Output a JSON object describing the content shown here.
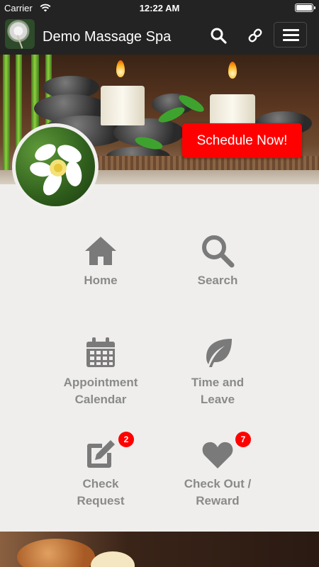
{
  "status_bar": {
    "carrier": "Carrier",
    "time": "12:22 AM"
  },
  "nav": {
    "title": "Demo Massage Spa"
  },
  "hero": {
    "schedule_label": "Schedule Now!"
  },
  "grid": [
    {
      "label_lines": [
        "Home"
      ],
      "icon": "home-icon"
    },
    {
      "label_lines": [
        "Search"
      ],
      "icon": "search-icon"
    },
    {
      "label_lines": [
        "Appointment",
        "Calendar"
      ],
      "icon": "calendar-icon"
    },
    {
      "label_lines": [
        "Time and",
        "Leave"
      ],
      "icon": "leaf-icon"
    },
    {
      "label_lines": [
        "Check",
        "Request"
      ],
      "icon": "edit-icon",
      "badge": "2"
    },
    {
      "label_lines": [
        "Check Out /",
        "Reward"
      ],
      "icon": "heart-icon",
      "badge": "7"
    }
  ],
  "colors": {
    "accent": "#ff0000",
    "icon_gray": "#7a7a7a",
    "label_gray": "#8a8a8a",
    "bar": "#232323",
    "page_bg": "#efeeec"
  }
}
